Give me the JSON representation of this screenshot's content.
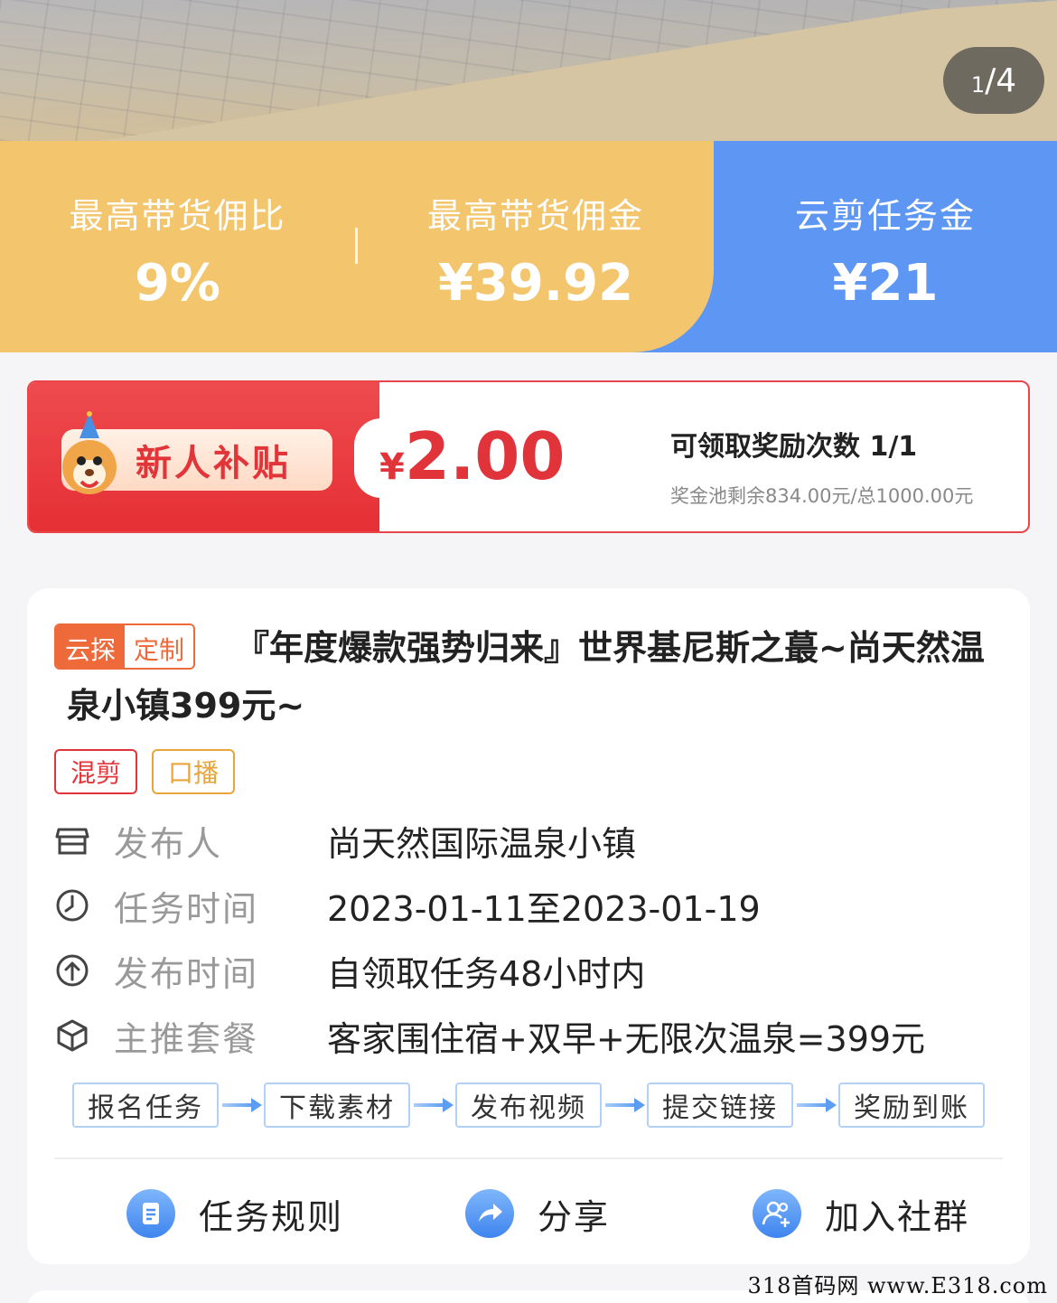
{
  "hero": {
    "pager_current": "1",
    "pager_total": "/4"
  },
  "commission": {
    "max_ratio_label": "最高带货佣比",
    "max_ratio_value": "9%",
    "max_commission_label": "最高带货佣金",
    "max_commission_value": "¥39.92",
    "task_fee_label": "云剪任务金",
    "task_fee_value": "¥21",
    "colors": {
      "left_bg": "#f3c56c",
      "right_bg": "#5e97f3"
    }
  },
  "subsidy": {
    "badge": "新人补贴",
    "currency": "¥",
    "amount": "2.00",
    "times_label": "可领取奖励次数 1/1",
    "pool_label": "奖金池剩余834.00元/总1000.00元",
    "accent_color": "#e1353a"
  },
  "task": {
    "badge_left": "云探",
    "badge_right": "定制",
    "title": "『年度爆款强势归来』世界基尼斯之蕞~尚天然温泉小镇399元~",
    "tags": [
      "混剪",
      "口播"
    ],
    "info": [
      {
        "icon": "store-icon",
        "key": "发布人",
        "value": "尚天然国际温泉小镇"
      },
      {
        "icon": "clock-icon",
        "key": "任务时间",
        "value": "2023-01-11至2023-01-19"
      },
      {
        "icon": "upload-icon",
        "key": "发布时间",
        "value": "自领取任务48小时内"
      },
      {
        "icon": "package-icon",
        "key": "主推套餐",
        "value": "客家围住宿+双早+无限次温泉=399元"
      }
    ],
    "steps": [
      "报名任务",
      "下载素材",
      "发布视频",
      "提交链接",
      "奖励到账"
    ],
    "actions": [
      {
        "icon": "document-icon",
        "label": "任务规则"
      },
      {
        "icon": "share-icon",
        "label": "分享"
      },
      {
        "icon": "group-add-icon",
        "label": "加入社群"
      }
    ]
  },
  "watermark": "318首码网 www.E318.com"
}
